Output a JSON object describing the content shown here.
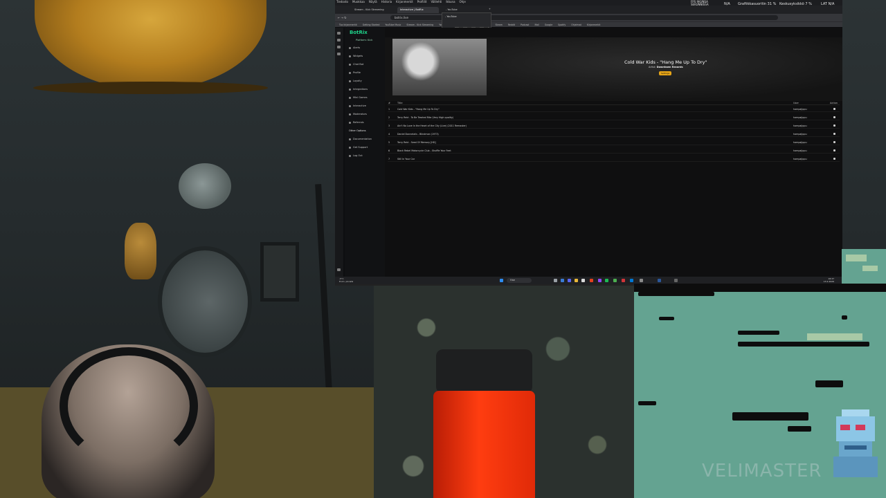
{
  "os": {
    "menu": [
      "Tiedosto",
      "Muokkaa",
      "Näytä",
      "Historia",
      "Kirjanmerkit",
      "Profiilit",
      "Välilehti",
      "Ikkuna",
      "Ohje"
    ],
    "fps_label": "FPS 9KUNSA SEKUNNISSA",
    "hud": [
      "N/A",
      "Grafiikkasuoritin 31 %",
      "Keskusyksikkö 7 %",
      "LAT N/A"
    ]
  },
  "browser": {
    "tabs": [
      {
        "label": "Stream - Kick Streaming",
        "active": false
      },
      {
        "label": "Interactive | BotRix",
        "active": true
      },
      {
        "label": "- YouTube",
        "active": false
      }
    ],
    "url": "botrix.live",
    "bookmarks": [
      "Tuo kirjanmerkit",
      "Getting Started",
      "YouTube Music",
      "Stream - Kick Streaming",
      "Youtube",
      "Twitch",
      "Facebook",
      "Images",
      "Steam",
      "Reddit",
      "Podcast",
      "Mail",
      "Google",
      "Spotify",
      "Ohjelmat",
      "Kirjanmerkit"
    ],
    "youtube_dropdown": "- YouTube"
  },
  "botrix": {
    "logo": "BotRix",
    "platform": "Platform: Kick",
    "nav": [
      {
        "label": "Alerts",
        "section": false
      },
      {
        "label": "Widgets",
        "section": false
      },
      {
        "label": "Chat Bot",
        "section": false
      },
      {
        "label": "Profile",
        "section": false
      },
      {
        "label": "Loyalty",
        "section": false
      },
      {
        "label": "Integrations",
        "section": false
      },
      {
        "label": "Mini Games",
        "section": false
      },
      {
        "label": "Interactive",
        "section": false
      },
      {
        "label": "Moderators",
        "section": false
      },
      {
        "label": "Referrals",
        "section": false
      },
      {
        "label": "Other Options",
        "section": true
      },
      {
        "label": "Documentation",
        "section": false
      },
      {
        "label": "Get Support",
        "section": false
      },
      {
        "label": "Log Out",
        "section": false
      }
    ],
    "now_playing": {
      "title": "Cold War Kids - \"Hang Me Up To Dry\"",
      "artist_label": "Artist:",
      "artist": "Downtown Records",
      "button": "Settings"
    },
    "table": {
      "headers": [
        "#",
        "Title",
        "User",
        "Action"
      ],
      "rows": [
        {
          "n": "1",
          "title": "Cold War Kids - \"Hang Me Up To Dry\"",
          "user": "hampajippu"
        },
        {
          "n": "2",
          "title": "Terry Reid - To Be Treated Rite (Very High quality)",
          "user": "hampajippu"
        },
        {
          "n": "3",
          "title": "Ain't No Love In the Heart of the City (Live) (2011 Remaster)",
          "user": "hampajippu"
        },
        {
          "n": "4",
          "title": "Daniel Donnelaiis - Blindman (1973)",
          "user": "hampajippu"
        },
        {
          "n": "5",
          "title": "Terry Reid - Seed Of Memory [HD]",
          "user": "hampajippu"
        },
        {
          "n": "6",
          "title": "Black Rebel Motorcycle Club - Shuffle Your Feet",
          "user": "hampajippu"
        },
        {
          "n": "7",
          "title": "Still In Your Car",
          "user": "hampajippu"
        }
      ]
    }
  },
  "taskbar": {
    "search": "Hae",
    "weather": "-5°C",
    "weather_sub": "Enim. pilvistä",
    "time": "18.37",
    "date": "13.2.2026"
  },
  "overlay": {
    "watermark": "VELIMASTER"
  },
  "colors": {
    "botrix_green": "#1fd38a",
    "game_bg": "#64a391",
    "mic_red": "#ff3d10",
    "buy_button": "#e6a417"
  }
}
